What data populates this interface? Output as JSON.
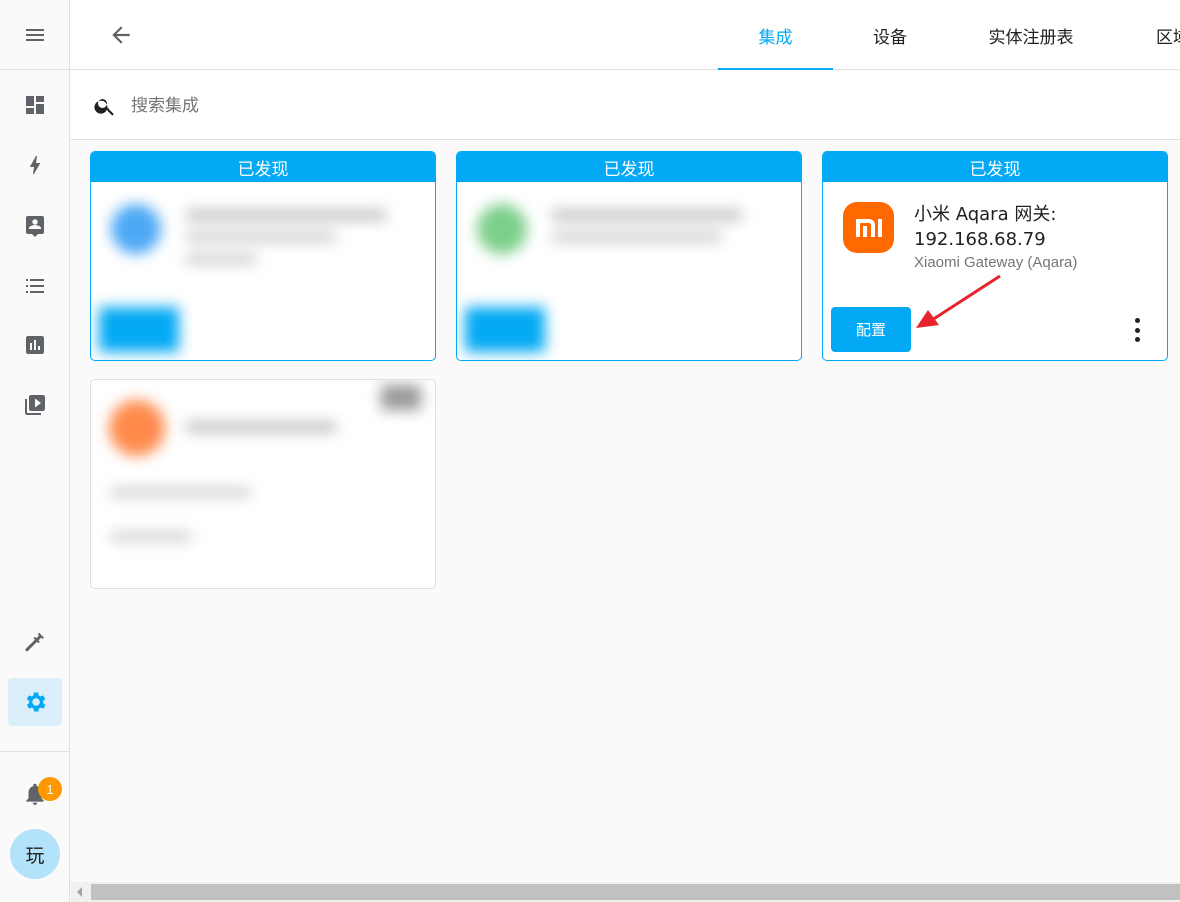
{
  "header": {
    "tabs": [
      {
        "label": "集成",
        "active": true
      },
      {
        "label": "设备",
        "active": false
      },
      {
        "label": "实体注册表",
        "active": false
      },
      {
        "label": "区域",
        "active": false
      }
    ]
  },
  "search": {
    "placeholder": "搜索集成"
  },
  "cards": [
    {
      "header": "已发现",
      "blurred": true
    },
    {
      "header": "已发现",
      "blurred": true
    },
    {
      "header": "已发现",
      "title": "小米 Aqara 网关: 192.168.68.79",
      "subtitle": "Xiaomi Gateway (Aqara)",
      "button": "配置",
      "logo_text": "mi"
    },
    {
      "blurred": true
    }
  ],
  "sidebar": {
    "items": [
      "dashboard-icon",
      "energy-icon",
      "logbook-icon",
      "todo-list-icon",
      "history-icon",
      "media-icon"
    ],
    "bottom_items": [
      "developer-tools-icon",
      "settings-icon"
    ],
    "notifications_count": "1",
    "user_initial": "玩"
  },
  "colors": {
    "accent": "#03a9f4",
    "brand_mi": "#ff6900",
    "badge": "#ff9800",
    "arrow": "#e8232c"
  }
}
